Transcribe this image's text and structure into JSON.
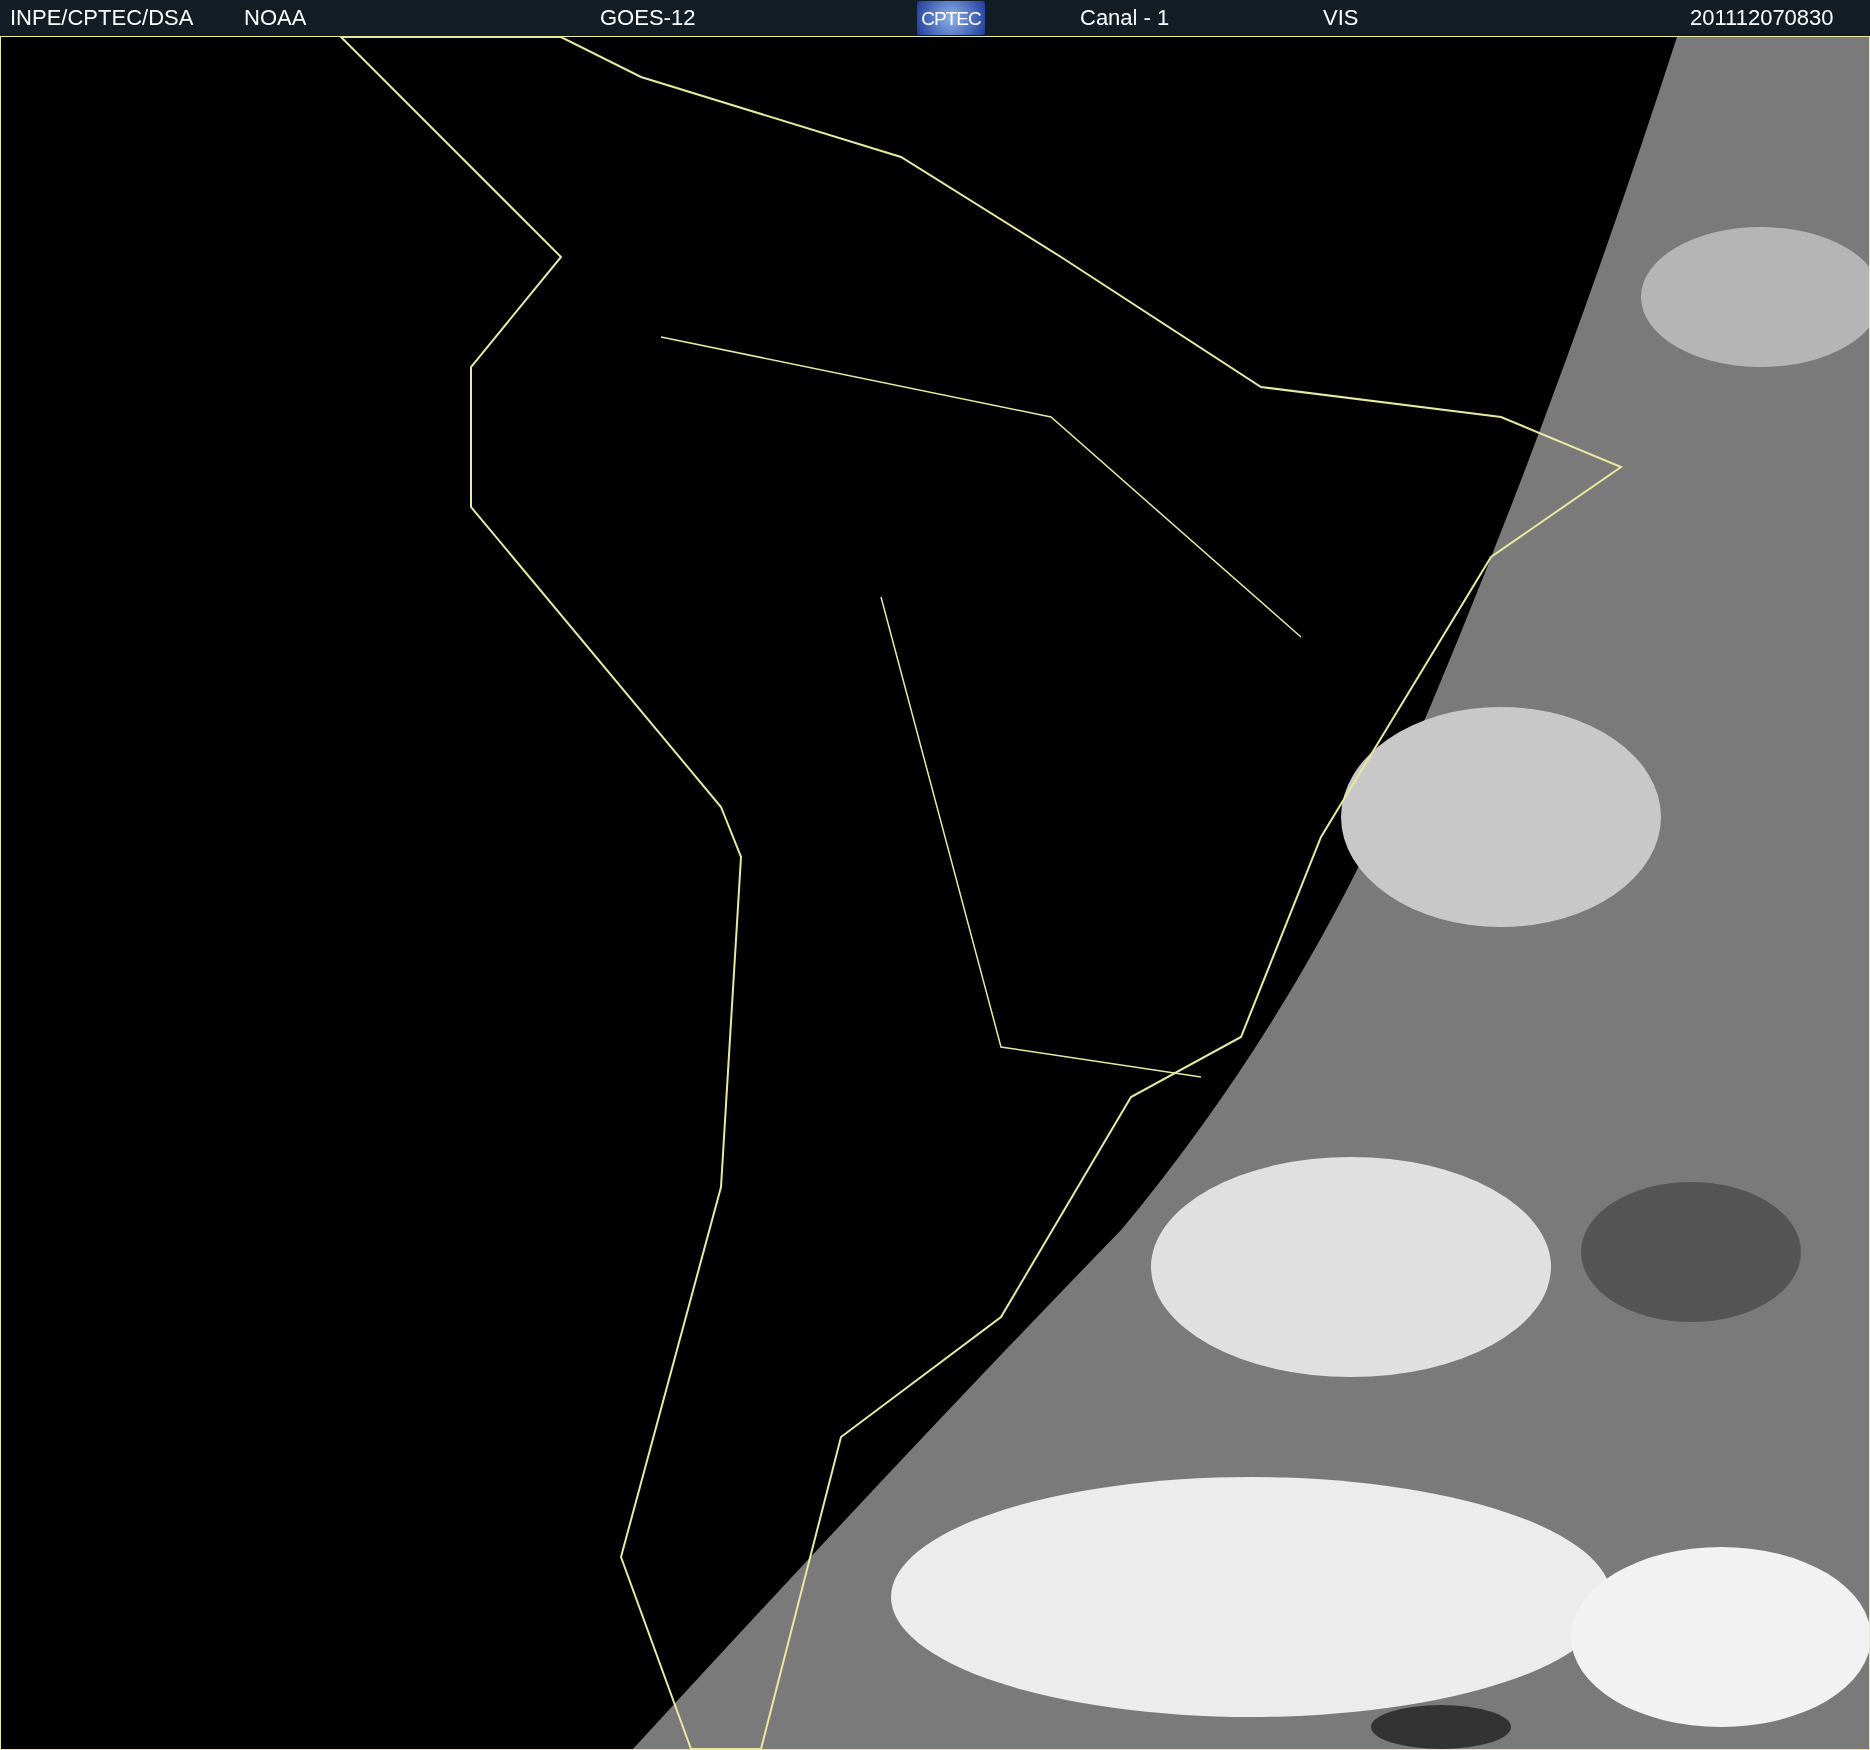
{
  "header": {
    "texts": [
      {
        "kind": "source",
        "text": "INPE/CPTEC/DSA"
      },
      {
        "kind": "agency",
        "text": "NOAA"
      },
      {
        "kind": "satellite",
        "text": "GOES-12"
      },
      {
        "kind": "channel",
        "text": "Canal - 1"
      },
      {
        "kind": "band",
        "text": "VIS"
      },
      {
        "kind": "timestamp",
        "text": "201112070830"
      }
    ],
    "logo": {
      "text": "CPTEC"
    }
  }
}
